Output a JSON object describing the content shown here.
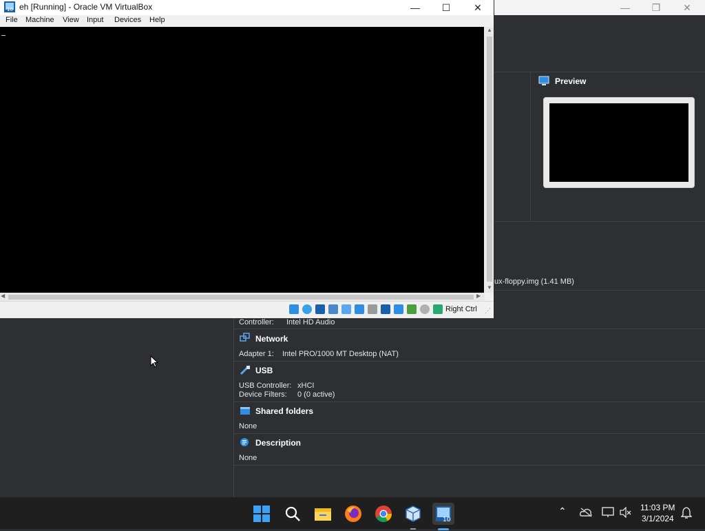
{
  "vm_window": {
    "title": "eh [Running] - Oracle VM VirtualBox",
    "minimize": "—",
    "maximize": "☐",
    "close": "✕",
    "menu": [
      "File",
      "Machine",
      "View",
      "Input",
      "Devices",
      "Help"
    ],
    "host_key": "Right Ctrl"
  },
  "manager": {
    "preview_title": "Preview",
    "storage_tail": "ux-floppy.img (1.41 MB)",
    "audio_controller_label": "Controller:",
    "audio_controller_value": "Intel HD Audio",
    "network_title": "Network",
    "network_adapter_label": "Adapter 1:",
    "network_adapter_value": "Intel PRO/1000 MT Desktop (NAT)",
    "usb_title": "USB",
    "usb_controller_label": "USB Controller:",
    "usb_controller_value": "xHCI",
    "usb_filters_label": "Device Filters:",
    "usb_filters_value": "0 (0 active)",
    "shared_title": "Shared folders",
    "shared_value": "None",
    "description_title": "Description",
    "description_value": "None"
  },
  "taskbar": {
    "time": "11:03 PM",
    "date": "3/1/2024"
  },
  "colors": {
    "accent_blue": "#2f8ee0",
    "dark_panel": "#2d2f32"
  }
}
